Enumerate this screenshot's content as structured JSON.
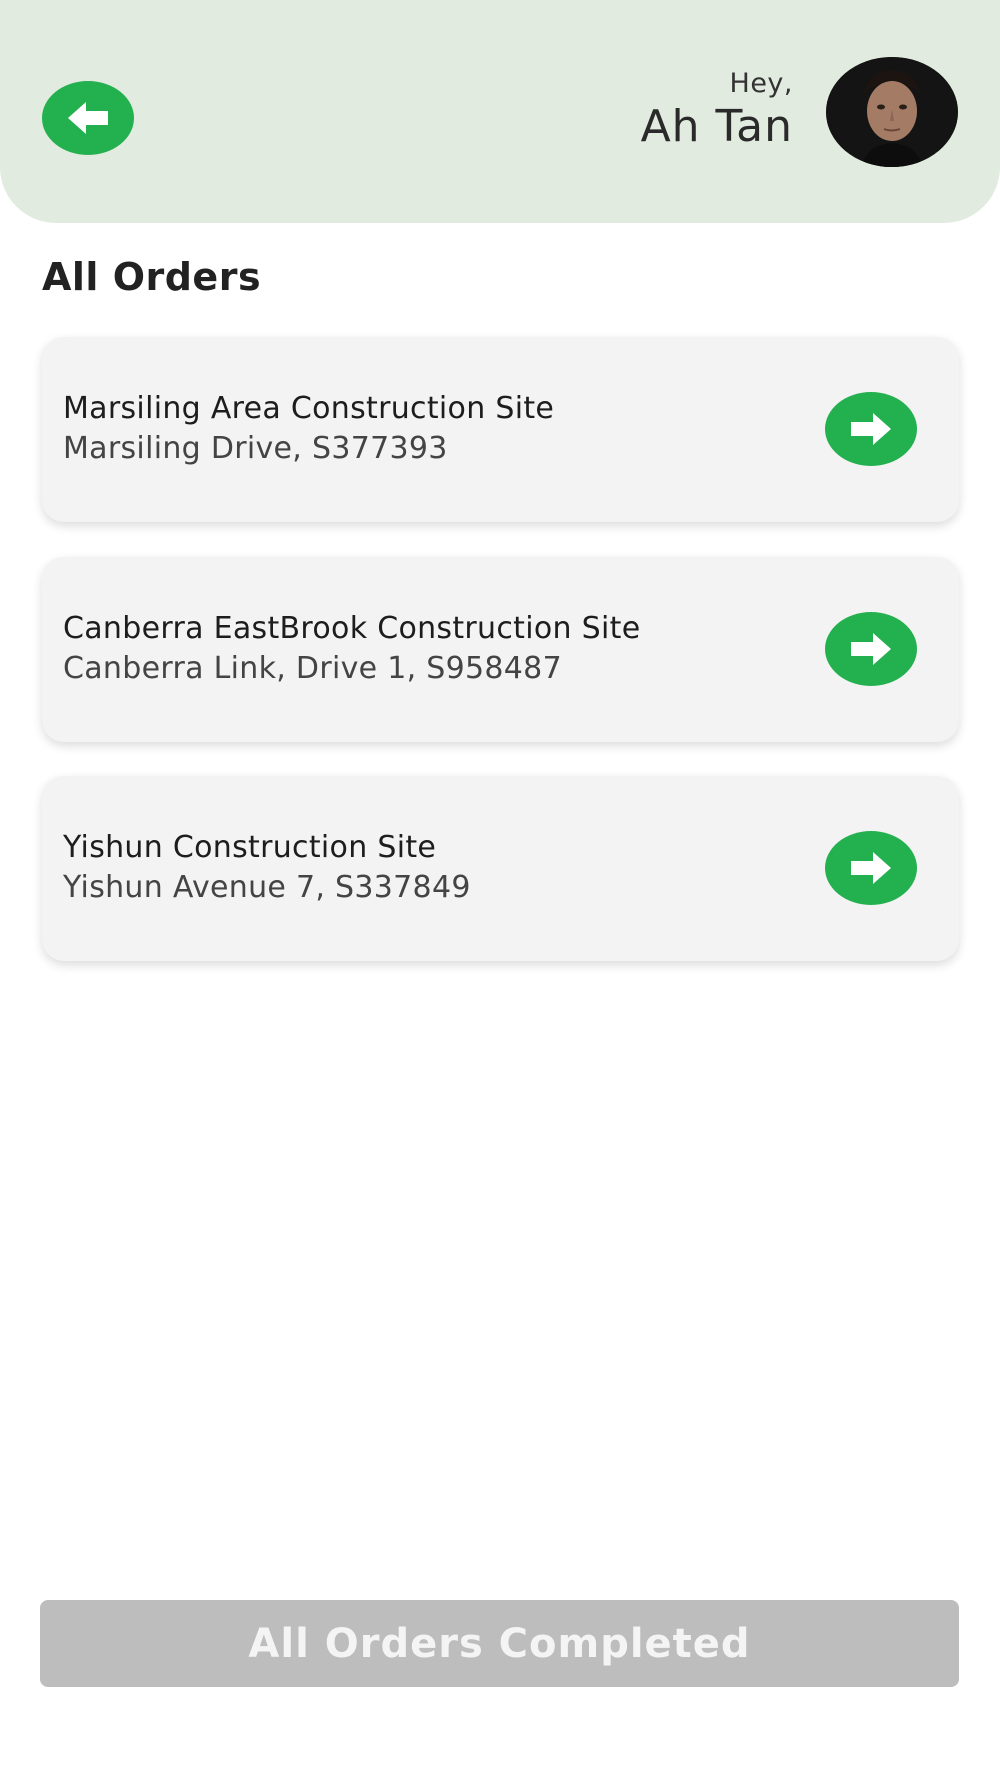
{
  "header": {
    "greeting": "Hey,",
    "user_name": "Ah Tan",
    "back_icon": "arrow-left-circle-icon",
    "avatar_icon": "user-avatar"
  },
  "orders_section": {
    "title": "All Orders",
    "items": [
      {
        "name": "Marsiling Area Construction Site",
        "address": "Marsiling Drive, S377393",
        "icon": "arrow-right-circle-icon"
      },
      {
        "name": "Canberra EastBrook Construction Site",
        "address": "Canberra Link, Drive 1, S958487",
        "icon": "arrow-right-circle-icon"
      },
      {
        "name": "Yishun Construction Site",
        "address": "Yishun Avenue 7, S337849",
        "icon": "arrow-right-circle-icon"
      }
    ]
  },
  "footer": {
    "complete_label": "All Orders Completed",
    "complete_state": "disabled"
  },
  "colors": {
    "header_bg": "#e1ebdf",
    "accent_green": "#23b04f",
    "card_bg": "#f3f3f3",
    "disabled_button_bg": "#bdbdbd"
  }
}
